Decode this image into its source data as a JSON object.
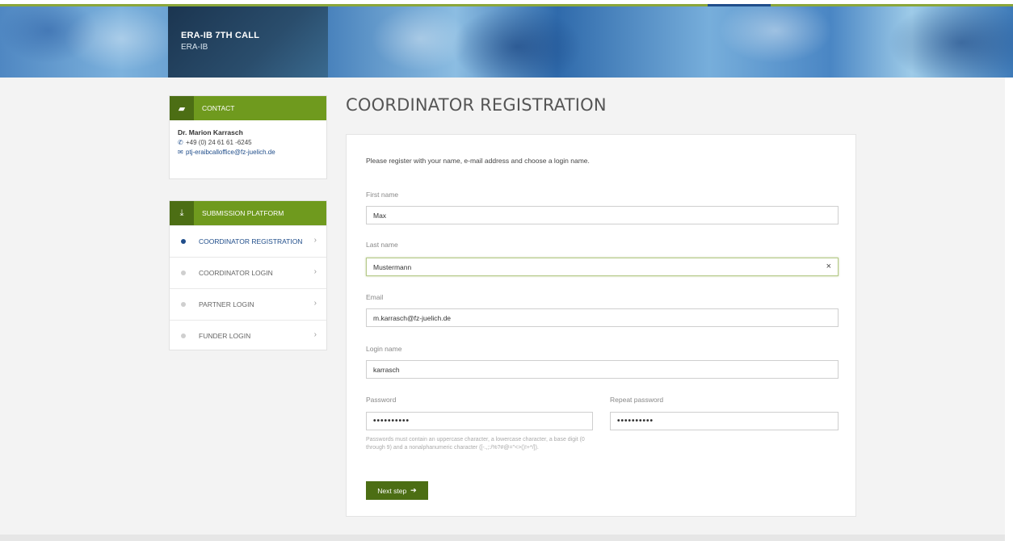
{
  "header": {
    "title": "ERA-IB 7TH CALL",
    "subtitle": "ERA-IB"
  },
  "contact": {
    "header": "CONTACT",
    "name": "Dr. Marion Karrasch",
    "phone": "+49 (0) 24 61 61 -6245",
    "email": "ptj-eraibcalloffice@fz-juelich.de"
  },
  "submission": {
    "header": "SUBMISSION PLATFORM",
    "items": [
      {
        "label": "COORDINATOR REGISTRATION",
        "active": true
      },
      {
        "label": "COORDINATOR LOGIN",
        "active": false
      },
      {
        "label": "PARTNER LOGIN",
        "active": false
      },
      {
        "label": "FUNDER LOGIN",
        "active": false
      }
    ]
  },
  "page": {
    "title": "COORDINATOR REGISTRATION"
  },
  "form": {
    "intro": "Please register with your name, e-mail address and choose a login name.",
    "first_name_label": "First name",
    "first_name_value": "Max",
    "last_name_label": "Last name",
    "last_name_value": "Mustermann",
    "email_label": "Email",
    "email_value": "m.karrasch@fz-juelich.de",
    "login_label": "Login name",
    "login_value": "karrasch",
    "password_label": "Password",
    "password_value": "••••••••••",
    "repeat_password_label": "Repeat password",
    "repeat_password_value": "••••••••••",
    "password_hint": "Passwords must contain an uppercase character, a lowercase character, a base digit (0 through 9) and a nonalphanumeric character ([-.,;:/%?#@=\"<>()!+*/]).",
    "next_label": "Next step",
    "clear_glyph": "×",
    "arrow_glyph": "➔"
  },
  "colors": {
    "accent_green": "#6f9a1e",
    "dark_green": "#4c6e14",
    "link_blue": "#1f4d8a"
  }
}
